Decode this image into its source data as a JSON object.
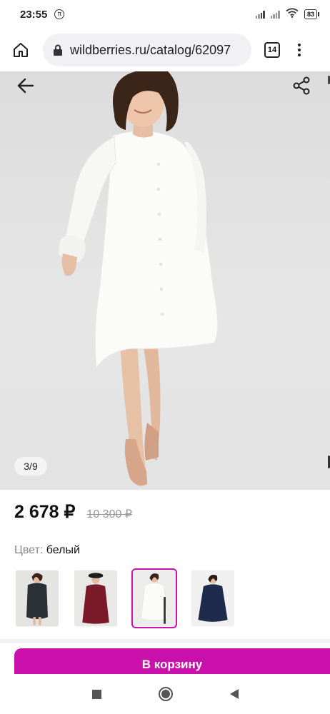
{
  "status_bar": {
    "time": "23:55",
    "pi_symbol": "π",
    "battery": "83"
  },
  "browser": {
    "url": "wildberries.ru/catalog/62097",
    "tab_count": "14"
  },
  "product": {
    "image_counter": "3/9",
    "price": "2 678 ₽",
    "old_price": "10 300 ₽",
    "color_label": "Цвет:",
    "color_value": "белый"
  },
  "variants": [
    {
      "name": "black",
      "dress_color": "#2b2f36",
      "selected": false
    },
    {
      "name": "burgundy",
      "dress_color": "#7a1a28",
      "selected": false
    },
    {
      "name": "white",
      "dress_color": "#f8f8f6",
      "selected": true
    },
    {
      "name": "navy",
      "dress_color": "#1f2b4d",
      "selected": false
    }
  ],
  "actions": {
    "add_to_cart": "В корзину"
  },
  "colors": {
    "accent": "#cb11ab",
    "image_background": "#e2e2e2"
  }
}
